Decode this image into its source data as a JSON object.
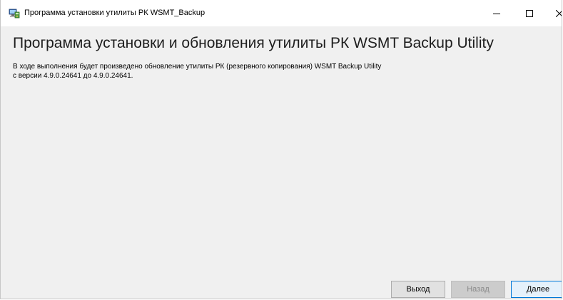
{
  "window": {
    "title": "Программа установки утилиты РК WSMT_Backup",
    "icon": "installer-computer-icon",
    "controls": {
      "minimize_icon": "minimize-icon",
      "maximize_icon": "maximize-icon",
      "close_icon": "close-icon"
    }
  },
  "main": {
    "heading": "Программа установки и обновления утилиты РК WSMT Backup Utility",
    "description_line1": "В ходе выполнения будет произведено обновление утилиты РК (резервного копирования) WSMT Backup Utility",
    "description_line2": "с версии 4.9.0.24641 до 4.9.0.24641."
  },
  "buttons": {
    "exit_label": "Выход",
    "back_label": "Назад",
    "next_label": "Далее"
  },
  "colors": {
    "accent": "#0078d7",
    "window_bg": "#f0f0f0",
    "titlebar_bg": "#ffffff"
  }
}
